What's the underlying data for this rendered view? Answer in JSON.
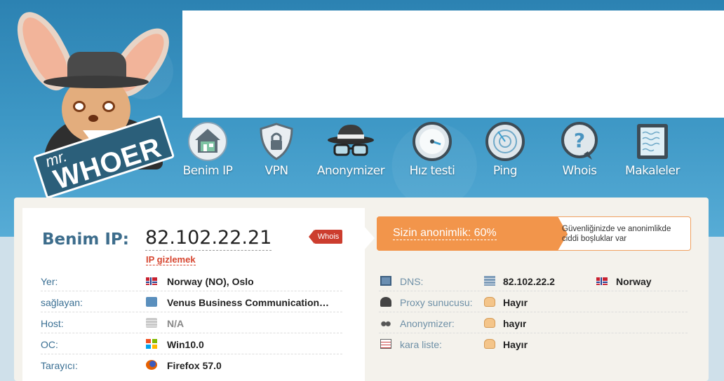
{
  "logo": {
    "mr": "mr.",
    "brand": "WHOER"
  },
  "nav": [
    {
      "label": "Benim IP",
      "icon": "home-icon"
    },
    {
      "label": "VPN",
      "icon": "shield-lock-icon"
    },
    {
      "label": "Anonymizer",
      "icon": "spy-hat-icon"
    },
    {
      "label": "Hız testi",
      "icon": "speedometer-icon"
    },
    {
      "label": "Ping",
      "icon": "radar-icon"
    },
    {
      "label": "Whois",
      "icon": "question-bubble-icon"
    },
    {
      "label": "Makaleler",
      "icon": "document-icon"
    }
  ],
  "ip_block": {
    "title": "Benim IP:",
    "ip": "82.102.22.21",
    "hide_link": "IP gizlemek",
    "whois_tag": "Whois"
  },
  "left_rows": [
    {
      "label": "Yer:",
      "icon": "norway-flag-icon",
      "value": "Norway (NO), Oslo"
    },
    {
      "label": "sağlayan:",
      "icon": "provider-icon",
      "value": "Venus Business Communication…"
    },
    {
      "label": "Host:",
      "icon": "host-icon",
      "value": "N/A"
    },
    {
      "label": "OC:",
      "icon": "windows-icon",
      "value": "Win10.0"
    },
    {
      "label": "Tarayıcı:",
      "icon": "firefox-icon",
      "value": "Firefox 57.0"
    }
  ],
  "anonymity": {
    "text": "Sizin anonimlik: 60%",
    "note": "Güvenliğinizde ve anonimlikde ciddi boşluklar var",
    "accent": "#f2954b"
  },
  "right_rows": [
    {
      "label": "DNS:",
      "icon": "dns-icon",
      "icon2": "server-icon",
      "value": "82.102.22.2",
      "flag": "norway-flag-icon",
      "extra": "Norway"
    },
    {
      "label": "Proxy sunucusu:",
      "icon": "spy-icon",
      "icon2": "thumbs-up-icon",
      "value": "Hayır"
    },
    {
      "label": "Anonymizer:",
      "icon": "glasses-icon",
      "icon2": "thumbs-up-icon",
      "value": "hayır"
    },
    {
      "label": "kara liste:",
      "icon": "list-icon",
      "icon2": "thumbs-up-icon",
      "value": "Hayır"
    }
  ]
}
